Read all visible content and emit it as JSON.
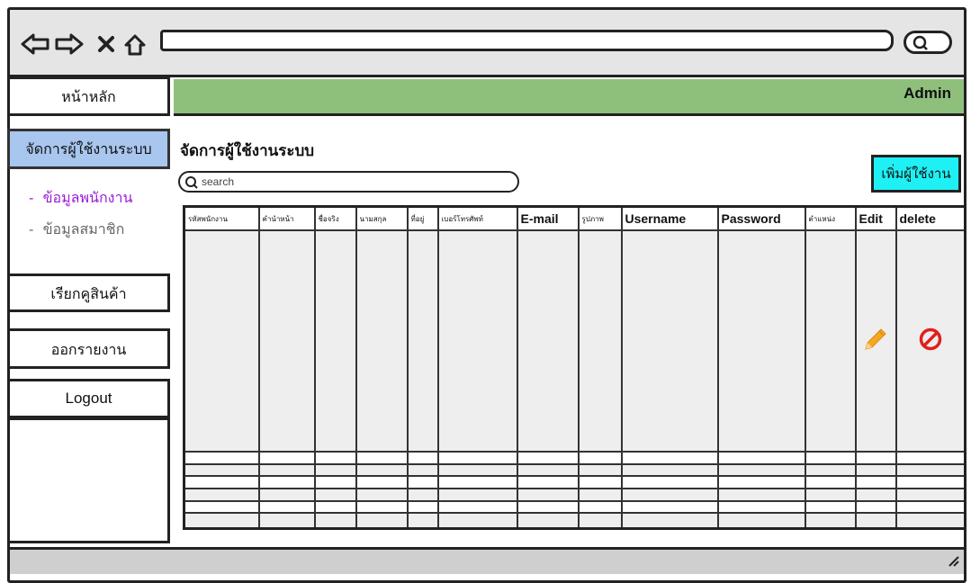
{
  "sidebar": {
    "home": "หน้าหลัก",
    "manage_users": "จัดการผู้ใช้งานระบบ",
    "sub_employees": "ข้อมูลพนักงาน",
    "sub_members": "ข้อมูลสมาชิก",
    "recall_products": "เรียกคูสินค้า",
    "reports": "ออกรายงาน",
    "logout": "Logout"
  },
  "header": {
    "user": "Admin"
  },
  "main": {
    "title": "จัดการผู้ใช้งานระบบ",
    "search_placeholder": "search",
    "add_user_label": "เพิ่มผู้ใช้งาน"
  },
  "table": {
    "columns": [
      "รหัสพนักงาน",
      "คำนำหน้า",
      "ชื่อจริง",
      "นามสกุล",
      "ที่อยู่",
      "เบอร์โทรศัพท์",
      "E-mail",
      "รูปภาพ",
      "Username",
      "Password",
      "ตำแหน่ง",
      "Edit",
      "delete"
    ],
    "row_count": 7
  },
  "colors": {
    "header": "#8ec07c",
    "active_sidebar": "#a8c6ee",
    "add_button": "#1ef0f4",
    "sub_active": "#9b1bd6",
    "edit_icon": "#f5a623",
    "delete_icon": "#e0201b"
  },
  "icons": [
    "back-icon",
    "forward-icon",
    "close-icon",
    "home-icon",
    "search-icon",
    "edit-pencil-icon",
    "delete-ban-icon"
  ]
}
